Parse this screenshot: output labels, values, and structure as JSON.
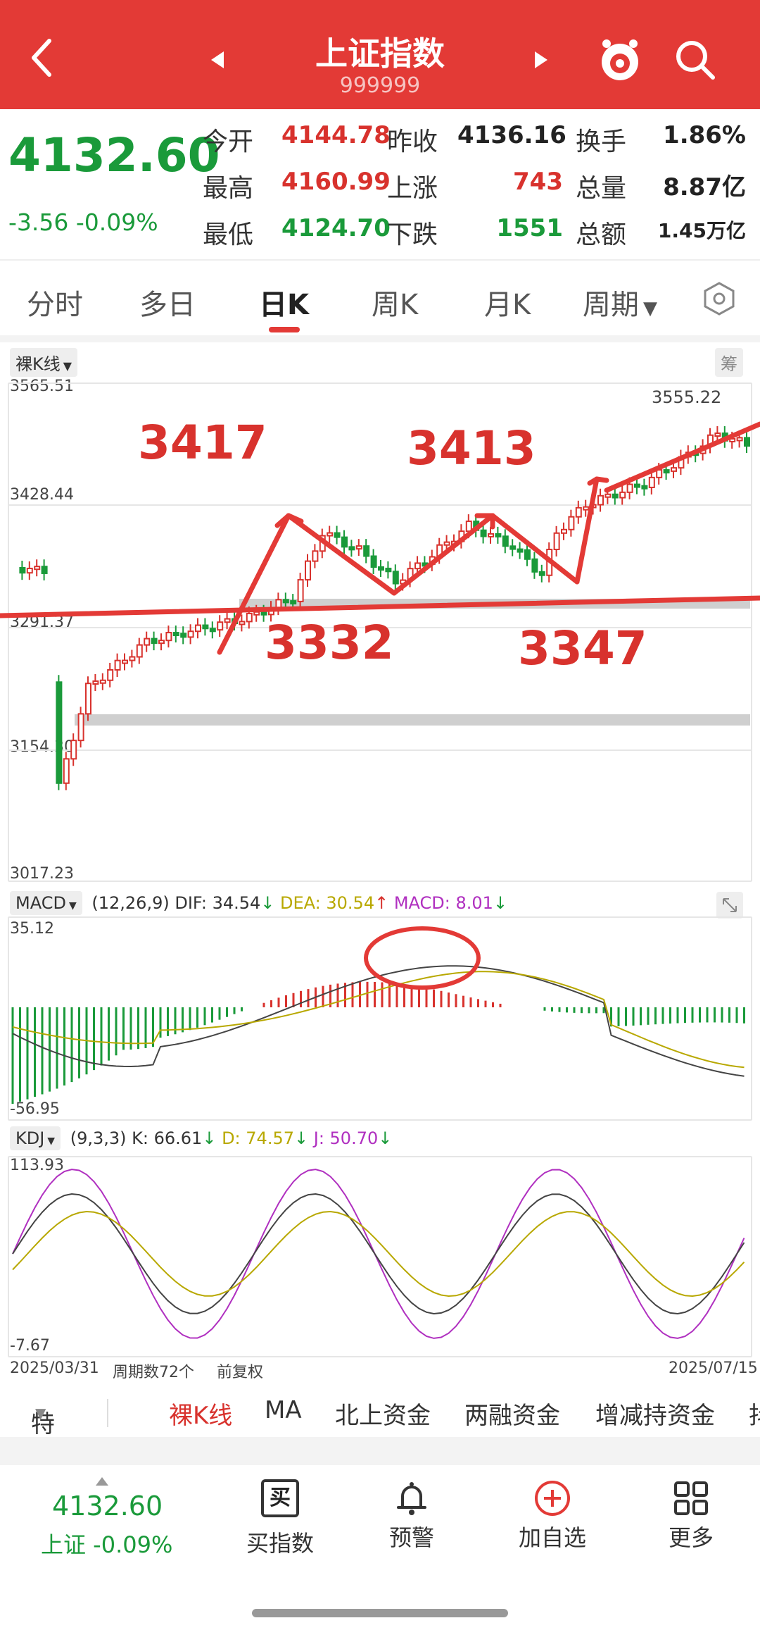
{
  "header": {
    "title": "上证指数",
    "code": "999999"
  },
  "quote": {
    "price": "4132.60",
    "change": "-3.56 -0.09%",
    "rows": [
      [
        {
          "l": "今开",
          "v": "4144.78",
          "c": "red"
        },
        {
          "l": "昨收",
          "v": "4136.16",
          "c": "black"
        },
        {
          "l": "换手",
          "v": "1.86%",
          "c": "black"
        }
      ],
      [
        {
          "l": "最高",
          "v": "4160.99",
          "c": "red"
        },
        {
          "l": "上涨",
          "v": "743",
          "c": "red"
        },
        {
          "l": "总量",
          "v": "8.87亿",
          "c": "black"
        }
      ],
      [
        {
          "l": "最低",
          "v": "4124.70",
          "c": "green"
        },
        {
          "l": "下跌",
          "v": "1551",
          "c": "green"
        },
        {
          "l": "总额",
          "v": "1.45万亿",
          "c": "black"
        }
      ]
    ]
  },
  "tabs": [
    "分时",
    "多日",
    "日K",
    "周K",
    "月K",
    "周期"
  ],
  "kline": {
    "mode_label": "裸K线",
    "chip_label": "筹",
    "y_ticks": [
      "3565.51",
      "3428.44",
      "3291.37",
      "3154.30",
      "3017.23"
    ],
    "high_label": "3555.22",
    "annotations": [
      "3417",
      "3413",
      "3332",
      "3347"
    ]
  },
  "macd": {
    "name": "MACD",
    "params": "(12,26,9)",
    "dif": "DIF: 34.54",
    "dea": "DEA: 30.54",
    "macd": "MACD: 8.01",
    "max": "35.12",
    "min": "-56.95"
  },
  "kdj": {
    "name": "KDJ",
    "params": "(9,3,3)",
    "k": "K: 66.61",
    "d": "D: 74.57",
    "j": "J: 50.70",
    "max": "113.93",
    "min": "-7.67"
  },
  "footer_axis": {
    "start": "2025/03/31",
    "count": "周期数72个",
    "adj": "前复权",
    "end": "2025/07/15"
  },
  "bottom_tabs": [
    "特色",
    "裸K线",
    "MA",
    "北上资金",
    "两融资金",
    "增减持资金",
    "抖"
  ],
  "nav": {
    "price": "4132.60",
    "price_sub": "上证 -0.09%",
    "items": [
      {
        "label": "买指数",
        "icon": "buy-icon"
      },
      {
        "label": "预警",
        "icon": "bell-icon"
      },
      {
        "label": "加自选",
        "icon": "add-favorite-icon"
      },
      {
        "label": "更多",
        "icon": "grid-icon"
      }
    ]
  },
  "colors": {
    "brand_red": "#e33a36",
    "up": "#d8322d",
    "down": "#1a9a3a",
    "dea_yellow": "#b8a800",
    "macd_purple": "#b030c0"
  }
}
